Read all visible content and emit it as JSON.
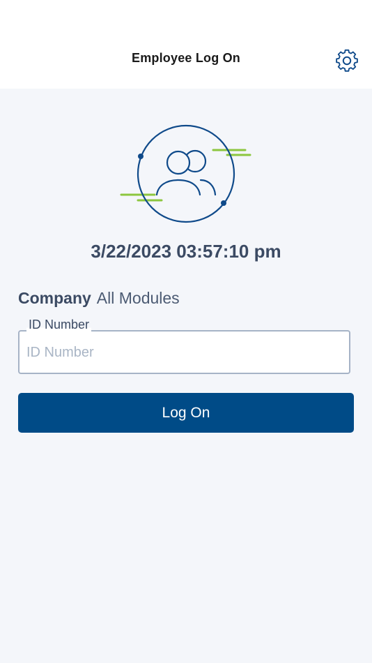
{
  "header": {
    "title": "Employee Log On",
    "settings_icon": "gear-icon"
  },
  "hero": {
    "icon": "users-icon",
    "accent_color": "#8cc63f",
    "primary_color": "#0f4a8a"
  },
  "datetime": "3/22/2023 03:57:10 pm",
  "company": {
    "label": "Company",
    "value": "All Modules"
  },
  "id_field": {
    "label": "ID Number",
    "placeholder": "ID Number",
    "value": ""
  },
  "logon_button": {
    "label": "Log On",
    "color": "#004b87"
  },
  "colors": {
    "background": "#f4f6fa",
    "header_bg": "#ffffff",
    "text_primary": "#3b4a63"
  }
}
